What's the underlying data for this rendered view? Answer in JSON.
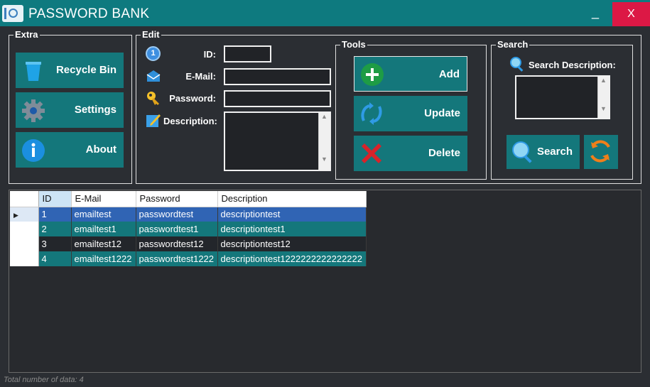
{
  "window": {
    "title": "PASSWORD BANK",
    "minimize": "_",
    "close": "X"
  },
  "extra": {
    "label": "Extra",
    "buttons": [
      {
        "label": "Recycle Bin",
        "icon": "trash-icon"
      },
      {
        "label": "Settings",
        "icon": "gear-icon"
      },
      {
        "label": "About",
        "icon": "info-icon"
      }
    ]
  },
  "edit": {
    "label": "Edit",
    "id_label": "ID:",
    "email_label": "E-Mail:",
    "password_label": "Password:",
    "description_label": "Description:",
    "id_value": "",
    "email_value": "",
    "password_value": "",
    "description_value": "",
    "id_badge": "1"
  },
  "tools": {
    "label": "Tools",
    "add": "Add",
    "update": "Update",
    "delete": "Delete"
  },
  "search": {
    "label": "Search",
    "description_label": "Search Description:",
    "query": "",
    "search_button": "Search"
  },
  "table": {
    "columns": [
      "ID",
      "E-Mail",
      "Password",
      "Description"
    ],
    "rows": [
      {
        "id": "1",
        "email": "emailtest",
        "password": "passwordtest",
        "description": "descriptiontest"
      },
      {
        "id": "2",
        "email": "emailtest1",
        "password": "passwordtest1",
        "description": "descriptiontest1"
      },
      {
        "id": "3",
        "email": "emailtest12",
        "password": "passwordtest12",
        "description": "descriptiontest12"
      },
      {
        "id": "4",
        "email": "emailtest1222",
        "password": "passwordtest1222",
        "description": "descriptiontest1222222222222222"
      }
    ]
  },
  "status": {
    "text": "Total number of data: 4"
  },
  "colors": {
    "teal": "#14777b",
    "titlebar": "#0e7a7f",
    "close": "#dc1845",
    "selected": "#3064b4",
    "background": "#2b2e33"
  }
}
